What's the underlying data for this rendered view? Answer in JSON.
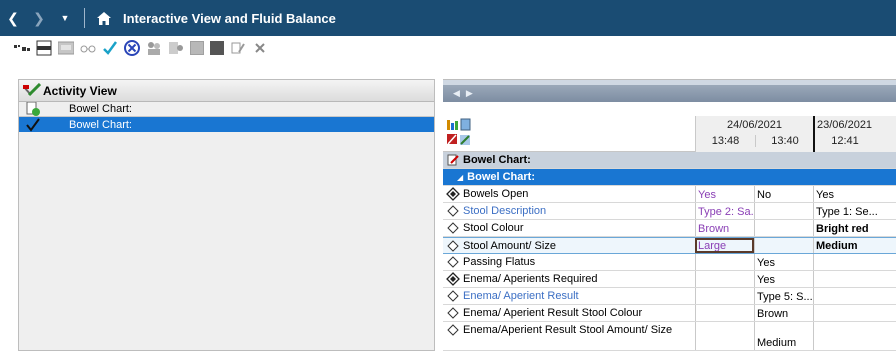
{
  "window": {
    "title": "Interactive View and Fluid Balance"
  },
  "left_pane": {
    "header": "Activity View",
    "items": [
      {
        "label": "Bowel Chart:",
        "selected": false
      },
      {
        "label": "Bowel Chart:",
        "selected": true
      }
    ]
  },
  "grid": {
    "columns": [
      {
        "date": "24/06/2021",
        "times": [
          "13:48",
          "13:40"
        ]
      },
      {
        "date": "23/06/2021",
        "times": [
          "12:41"
        ]
      }
    ],
    "section": "Bowel Chart:",
    "subsection": "Bowel Chart:",
    "rows": [
      {
        "label": "Bowels Open",
        "c1": "Yes",
        "c2": "No",
        "c3": "Yes"
      },
      {
        "label": "Stool Description",
        "c1": "Type 2: Sa...",
        "c2": "",
        "c3": "Type 1: Se..."
      },
      {
        "label": "Stool Colour",
        "c1": "Brown",
        "c2": "",
        "c3": "Bright red"
      },
      {
        "label": "Stool Amount/ Size",
        "c1": "Large",
        "c2": "",
        "c3": "Medium"
      },
      {
        "label": "Passing Flatus",
        "c1": "",
        "c2": "Yes",
        "c3": ""
      },
      {
        "label": "Enema/ Aperients Required",
        "c1": "",
        "c2": "Yes",
        "c3": ""
      },
      {
        "label": "Enema/ Aperient Result",
        "c1": "",
        "c2": "Type 5: S...",
        "c3": ""
      },
      {
        "label": "Enema/ Aperient Result Stool Colour",
        "c1": "",
        "c2": "Brown",
        "c3": ""
      },
      {
        "label": "Enema/Aperient Result Stool Amount/ Size",
        "c1": "",
        "c2": "Medium",
        "c3": ""
      }
    ]
  },
  "colors": {
    "titlebar": "#1a4c73",
    "selection": "#1976d2",
    "link": "#3c6fc4",
    "unsigned_value": "#8a3fb5"
  }
}
